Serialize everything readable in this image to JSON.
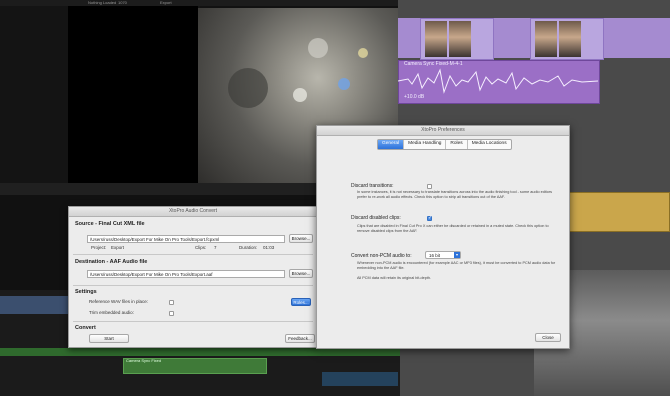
{
  "background": {
    "top_strip_labels": [
      "Nothing Loaded",
      "1070",
      "Export"
    ],
    "audio_clip_title": "Camera Sync Fixed-M-4-1",
    "audio_clip_gain": "+10.0 dB",
    "green_clip_title": "Camera Sync Fixed"
  },
  "convert_dialog": {
    "title": "XtoPro Audio Convert",
    "source_section": "Source - Final Cut XML file",
    "source_path": "/Users/russ/Desktop/Export For Mike On Pro Tools/Export.fcpxml",
    "browse_label": "Browse...",
    "project_label": "Project:",
    "project_value": "Export",
    "clips_label": "Clips:",
    "clips_value": "7",
    "duration_label": "Duration:",
    "duration_value": "01:03",
    "destination_section": "Destination - AAF Audio file",
    "destination_path": "/Users/russ/Desktop/Export For Mike On Pro Tools/Export.aaf",
    "browse2_label": "Browse...",
    "settings_section": "Settings",
    "reference_wav_label": "Reference WAV files in place:",
    "trim_label": "Trim embedded audio:",
    "blue_button_label": "Roles...",
    "convert_section": "Convert",
    "start_label": "Start",
    "feedback_label": "Feedback..."
  },
  "prefs_dialog": {
    "title": "XtoPro Preferences",
    "tabs": [
      "General",
      "Media Handling",
      "Roles",
      "Media Locations"
    ],
    "active_tab": "General",
    "discard_transitions_label": "Discard transitions:",
    "discard_transitions_desc": "In some instances, it is not necessary to translate transitions across into the audio finishing tool - some audio editors prefer to re-work all audio effects. Check this option to strip all transitions out of the AAF.",
    "discard_transitions_checked": false,
    "discard_disabled_label": "Discard disabled clips:",
    "discard_disabled_desc": "Clips that are disabled in Final Cut Pro X can either be discarded or retained in a muted state. Check this option to remove disabled clips from the AAF.",
    "discard_disabled_checked": true,
    "convert_label": "Convert non-PCM audio to:",
    "convert_value": "16 bit",
    "convert_desc": "Whenever non-PCM audio is encountered (for example AAC or MP3 files), it must be converted to PCM audio data for embedding into the AAF file.",
    "pcm_note": "All PCM data will retain its original bit-depth.",
    "close_label": "Close"
  },
  "colors": {
    "accent_blue": "#2d72d9",
    "purple_clip": "#9b6fc6",
    "yellow_clip": "#caa64b",
    "green_clip": "#3f7a38"
  }
}
